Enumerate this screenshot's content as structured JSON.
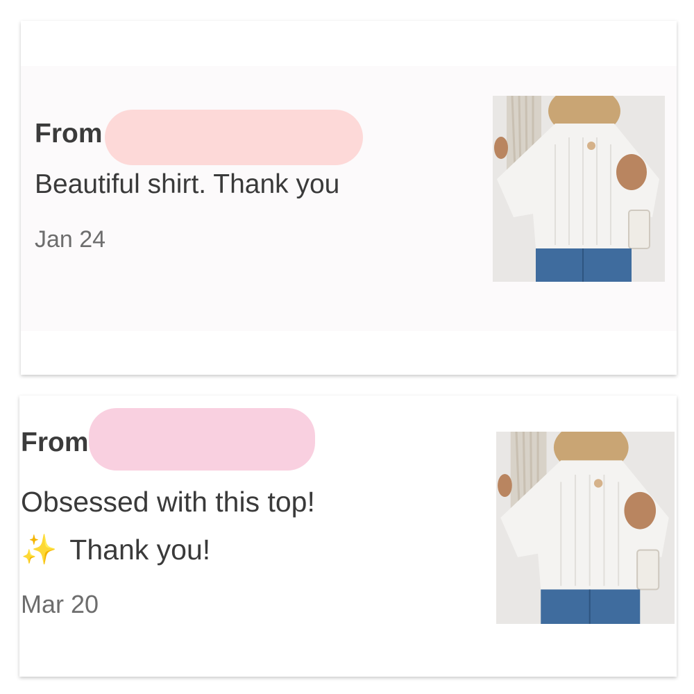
{
  "reviews": [
    {
      "from_label": "From",
      "message_lines": [
        "Beautiful shirt. Thank you"
      ],
      "date": "Jan 24",
      "redaction_color": "#fdd9d8",
      "thumbnail": "white-knit-sweater-photo"
    },
    {
      "from_label": "From",
      "message_lines": [
        "Obsessed with this top!",
        "Thank you!"
      ],
      "emoji": "✨",
      "date": "Mar 20",
      "redaction_color": "#f9d0e0",
      "thumbnail": "white-knit-sweater-photo"
    }
  ],
  "colors": {
    "text_primary": "#3a3a3a",
    "text_date": "#6d6d6d",
    "card_bg": "#ffffff",
    "card_inner_bg": "#fcfafb"
  }
}
